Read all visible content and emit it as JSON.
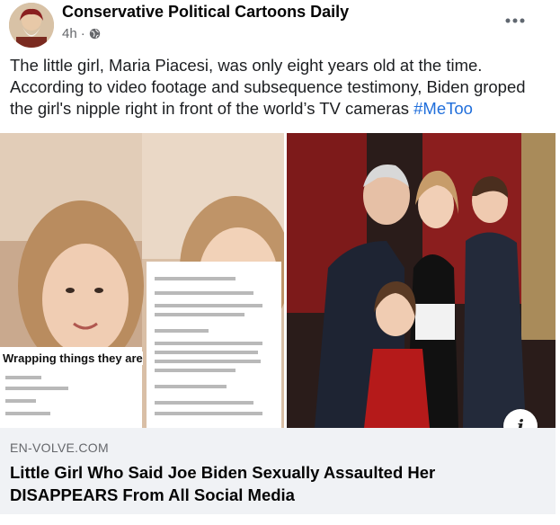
{
  "post": {
    "author": "Conservative Political Cartoons Daily",
    "time": "4h",
    "separator": "·",
    "privacy_icon": "globe-icon",
    "more_icon": "more-dots-icon",
    "caption_text": "The little girl, Maria Piacesi, was only eight years old at the time. According to video footage and subsequence testimony, Biden groped the girl's nipple right in front of the world’s TV cameras ",
    "hashtag": "#MeToo"
  },
  "image": {
    "left_overlay_text": "Wrapping things they are",
    "info_icon": "i"
  },
  "link": {
    "domain": "EN-VOLVE.COM",
    "headline": "Little Girl Who Said Joe Biden Sexually Assaulted Her DISAPPEARS From All Social Media"
  },
  "colors": {
    "hashtag": "#216fdb",
    "meta": "#65676b",
    "link_bg": "#f0f2f5"
  }
}
